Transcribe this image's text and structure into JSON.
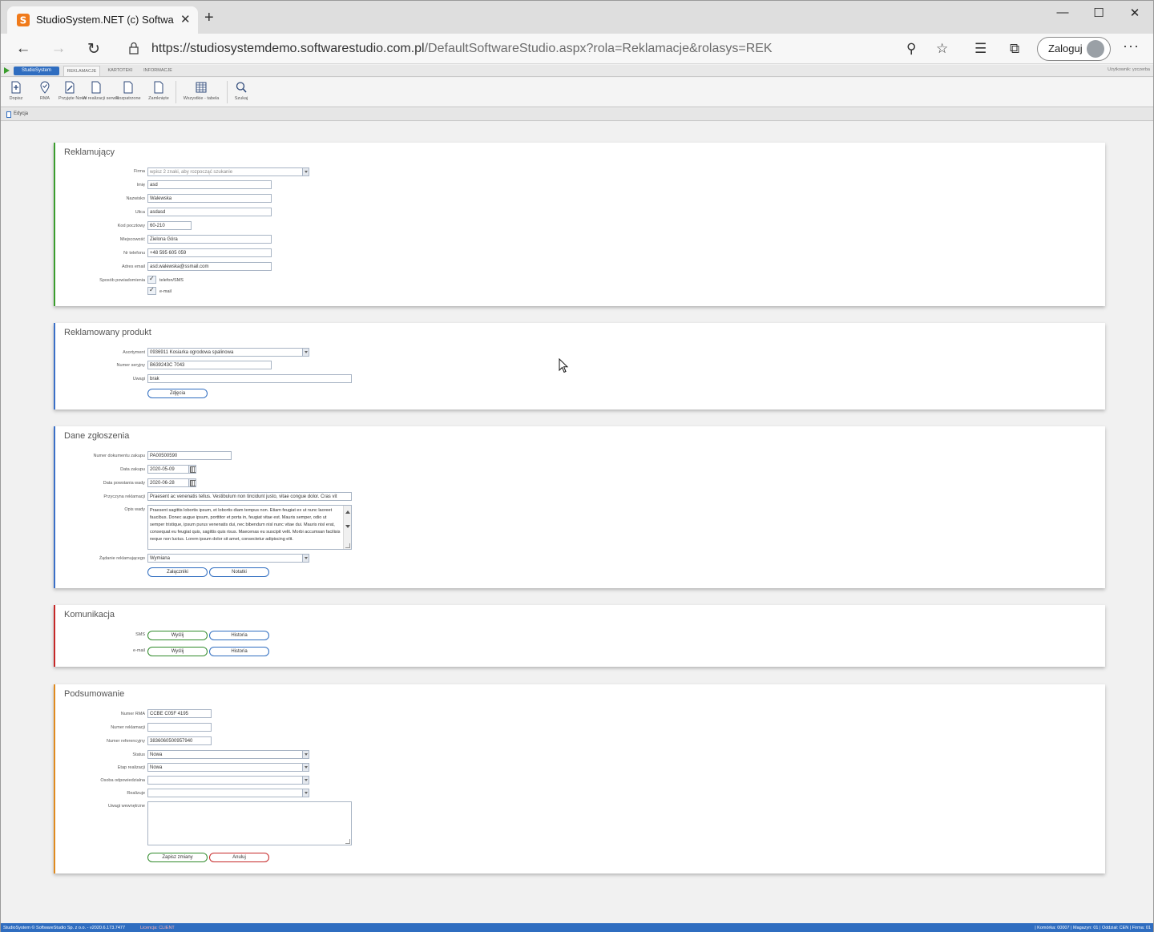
{
  "browser": {
    "tab_title": "StudioSystem.NET (c) SoftwareStudio",
    "close_glyph": "✕",
    "newtab_glyph": "+",
    "url_host": "https://studiosystemdemo.softwarestudio.com.pl",
    "url_path": "/DefaultSoftwareStudio.aspx?rola=Reklamacje&rolasys=REK",
    "login_label": "Zaloguj",
    "controls": {
      "minimize": "—",
      "maximize": "☐",
      "close": "✕"
    },
    "nav": {
      "back": "←",
      "forward": "→",
      "refresh": "↻",
      "zoom": "⚲",
      "favorite": "☆",
      "favorites": "☰",
      "collections": "⧉",
      "menu": "···"
    }
  },
  "app": {
    "brand": "StudioSystem",
    "tabs": [
      "REKLAMACJE",
      "KARTOTEKI",
      "INFORMACJE"
    ],
    "user": "Użytkownik: yzczerba",
    "ribbon": [
      {
        "label": "Dopisz",
        "icon": "add-document-icon"
      },
      {
        "label": "RMA",
        "icon": "location-icon"
      },
      {
        "label": "Przyjęte Nowe",
        "icon": "edit-document-icon"
      },
      {
        "label": "W realizacji serwis",
        "icon": "document-icon"
      },
      {
        "label": "Rozpatrzone",
        "icon": "document-icon"
      },
      {
        "label": "Zamknięte",
        "icon": "document-icon"
      },
      {
        "label": "Wszystkie - tabela",
        "icon": "table-icon"
      },
      {
        "label": "Szukaj",
        "icon": "search-icon"
      }
    ],
    "breadcrumb": "Edycja"
  },
  "reklamujacy": {
    "title": "Reklamujący",
    "firma_label": "Firma",
    "firma_placeholder": "wpisz 2 znaki, aby rozpocząć szukanie",
    "imie_label": "Imię",
    "imie": "asd",
    "nazwisko_label": "Nazwisko",
    "nazwisko": "Walewska",
    "ulica_label": "Ulica",
    "ulica": "asdasd",
    "kod_label": "Kod pocztowy",
    "kod": "60-210",
    "miejscowosc_label": "Miejscowość",
    "miejscowosc": "Zielona Góra",
    "telefon_label": "Nr telefonu",
    "telefon": "+48 595 605 059",
    "email_label": "Adres email",
    "email": "asd.walewska@ssmail.com",
    "sposob_label": "Sposób powiadomienia",
    "opt_sms": "telefon/SMS",
    "opt_email": "e-mail"
  },
  "produkt": {
    "title": "Reklamowany produkt",
    "asortyment_label": "Asortyment",
    "asortyment": "0936911 Kosiarka ogrodowa spalinowa",
    "seryjny_label": "Numer seryjny",
    "seryjny": "B639243C 7043",
    "uwagi_label": "Uwagi",
    "uwagi": "brak",
    "zdjecia_btn": "Zdjęcia"
  },
  "zgloszenie": {
    "title": "Dane zgłoszenia",
    "dok_label": "Numer dokumentu zakupu",
    "dok": "PA00500590",
    "data_zakupu_label": "Data zakupu",
    "data_zakupu": "2020-05-09",
    "data_wady_label": "Data powstania wady",
    "data_wady": "2020-06-28",
    "przyczyna_label": "Przyczyna reklamacji",
    "przyczyna": "Praesent ac venenatis tellus. Vestibulum non tincidunt justo, vitae congue dolor. Cras vit",
    "opis_label": "Opis wady",
    "opis": "Praesent sagittis lobortis ipsum, et lobortis diam tempus non. Etiam feugiat ex ut nunc laoreet faucibus. Donec augue ipsum, porttitor et porta in, feugiat vitae est. Mauris semper, odio ut semper tristique, ipsum purus venenatis dui, nec bibendum nisl nunc vitae dui. Mauris nisl erat, consequat eu feugiat quis, sagittis quis risus. Maecenas eu suscipit velit. Morbi accumsan facilisis neque non luctus. Lorem ipsum dolor sit amet, consectetur adipiscing elit.",
    "zadanie_label": "Żądanie reklamującego",
    "zadanie": "Wymiana",
    "zalaczniki_btn": "Załączniki",
    "notatki_btn": "Notatki"
  },
  "komunikacja": {
    "title": "Komunikacja",
    "sms_label": "SMS",
    "email_label": "e-mail",
    "wyslij_btn": "Wyślij",
    "historia_btn": "Historia"
  },
  "podsumowanie": {
    "title": "Podsumowanie",
    "rma_label": "Numer RMA",
    "rma": "CCBE C05F 4195",
    "nr_reklamacji_label": "Numer reklamacji",
    "nr_reklamacji": "",
    "ref_label": "Numer referencyjny",
    "ref": "3836060500957940",
    "status_label": "Status",
    "status": "Nowa",
    "etap_label": "Etap realizacji",
    "etap": "Nowa",
    "osoba_label": "Osoba odpowiedzialna",
    "osoba": "",
    "realizuje_label": "Realizuje",
    "realizuje": "",
    "uwagi_label": "Uwagi wewnętrzne",
    "uwagi": "",
    "save_btn": "Zapisz zmiany",
    "cancel_btn": "Anuluj"
  },
  "status": {
    "left": "StudioSystem © SoftwareStudio Sp. z o.o. - v2020.6.173.7477",
    "license": "Licencja: CLIENT",
    "right": "| Komórka: 00007 | Magazyn: 01 | Oddział: CEN | Firma: 01"
  },
  "colors": {
    "accent": "#2f6dc0",
    "green": "#3a9d2d",
    "red": "#c62828",
    "orange": "#e08a1e"
  }
}
